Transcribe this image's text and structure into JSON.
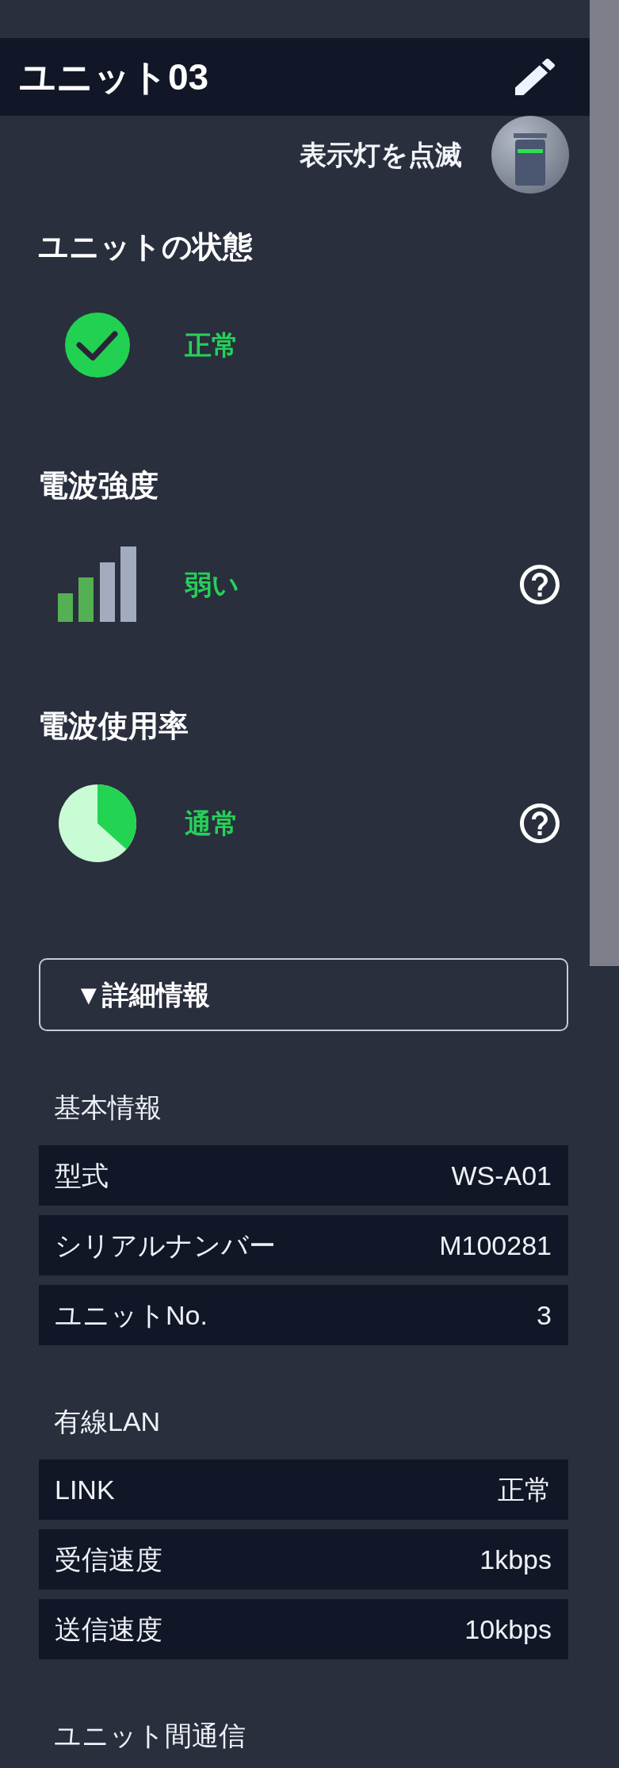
{
  "header": {
    "title": "ユニット03"
  },
  "blink_lamp": {
    "label": "表示灯を点滅"
  },
  "unit_status": {
    "heading": "ユニットの状態",
    "status": "正常"
  },
  "signal_strength": {
    "heading": "電波強度",
    "status": "弱い"
  },
  "channel_usage": {
    "heading": "電波使用率",
    "status": "通常"
  },
  "details_toggle": {
    "label": "▼詳細情報"
  },
  "sections": [
    {
      "title": "基本情報",
      "rows": [
        {
          "label": "型式",
          "value": "WS-A01"
        },
        {
          "label": "シリアルナンバー",
          "value": "M100281"
        },
        {
          "label": "ユニットNo.",
          "value": "3"
        }
      ]
    },
    {
      "title": "有線LAN",
      "rows": [
        {
          "label": "LINK",
          "value": "正常"
        },
        {
          "label": "受信速度",
          "value": "1kbps"
        },
        {
          "label": "送信速度",
          "value": "10kbps"
        }
      ]
    },
    {
      "title": "ユニット間通信"
    }
  ]
}
